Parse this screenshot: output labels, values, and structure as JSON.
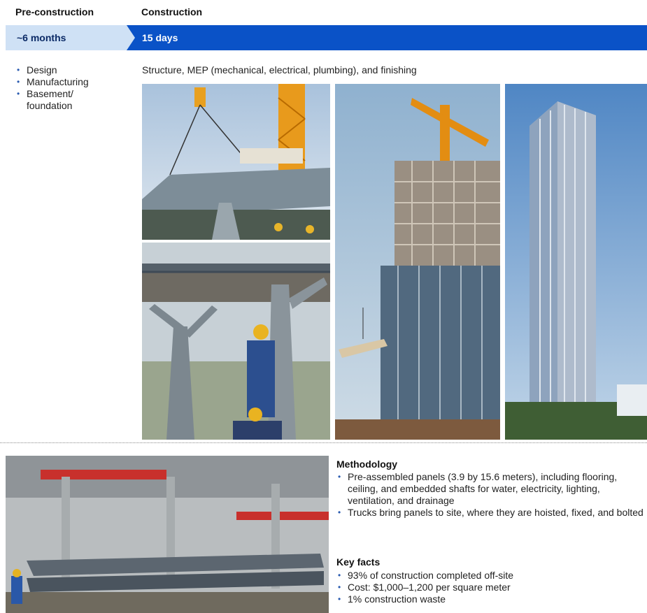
{
  "phases": {
    "pre": {
      "header": "Pre-construction",
      "duration": "~6 months",
      "items": [
        "Design",
        "Manufacturing",
        "Basement/ foundation"
      ]
    },
    "construction": {
      "header": "Construction",
      "duration": "15 days",
      "subtitle": "Structure, MEP (mechanical, electrical, plumbing), and finishing"
    }
  },
  "methodology": {
    "heading": "Methodology",
    "items": [
      "Pre-assembled panels (3.9 by 15.6 meters), including flooring, ceiling, and embedded shafts for water, electricity, lighting, ventilation, and drainage",
      "Trucks bring panels to site, where they are hoisted, fixed, and bolted"
    ]
  },
  "key_facts": {
    "heading": "Key facts",
    "items": [
      "93% of construction completed off-site",
      "Cost: $1,000–1,200 per square meter",
      "1% construction waste"
    ]
  },
  "colors": {
    "band_dark": "#0a52c7",
    "band_light": "#cfe1f5",
    "bullet": "#2a5bb0"
  },
  "photos": [
    "crane-lifting-panel-photo",
    "worker-bolting-column-photo",
    "tower-under-construction-photo",
    "completed-tower-photo",
    "factory-panels-photo"
  ]
}
